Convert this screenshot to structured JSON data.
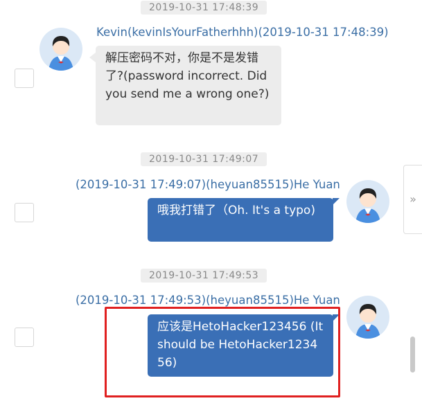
{
  "messages": [
    {
      "timestamp": "2019-10-31 17:48:39",
      "sender": "Kevin(kevinIsYourFatherhhh)(2019-10-31 17:48:39)",
      "text": "解压密码不对，你是不是发错了?(password incorrect. Did you send me a wrong one?)",
      "direction": "incoming"
    },
    {
      "timestamp": "2019-10-31 17:49:07",
      "sender": "(2019-10-31 17:49:07)(heyuan85515)He Yuan",
      "text": "哦我打错了（Oh. It's a typo)",
      "direction": "outgoing"
    },
    {
      "timestamp": "2019-10-31 17:49:53",
      "sender": "(2019-10-31 17:49:53)(heyuan85515)He Yuan",
      "text": "应该是HetoHacker123456 (It should be HetoHacker123456)",
      "direction": "outgoing"
    }
  ],
  "collapse_icon": "»",
  "colors": {
    "sender": "#3a6ea5",
    "bubble_in": "#ececec",
    "bubble_out": "#3a6fb6",
    "highlight": "#e02020",
    "avatar_bg": "#dbe8f6"
  }
}
